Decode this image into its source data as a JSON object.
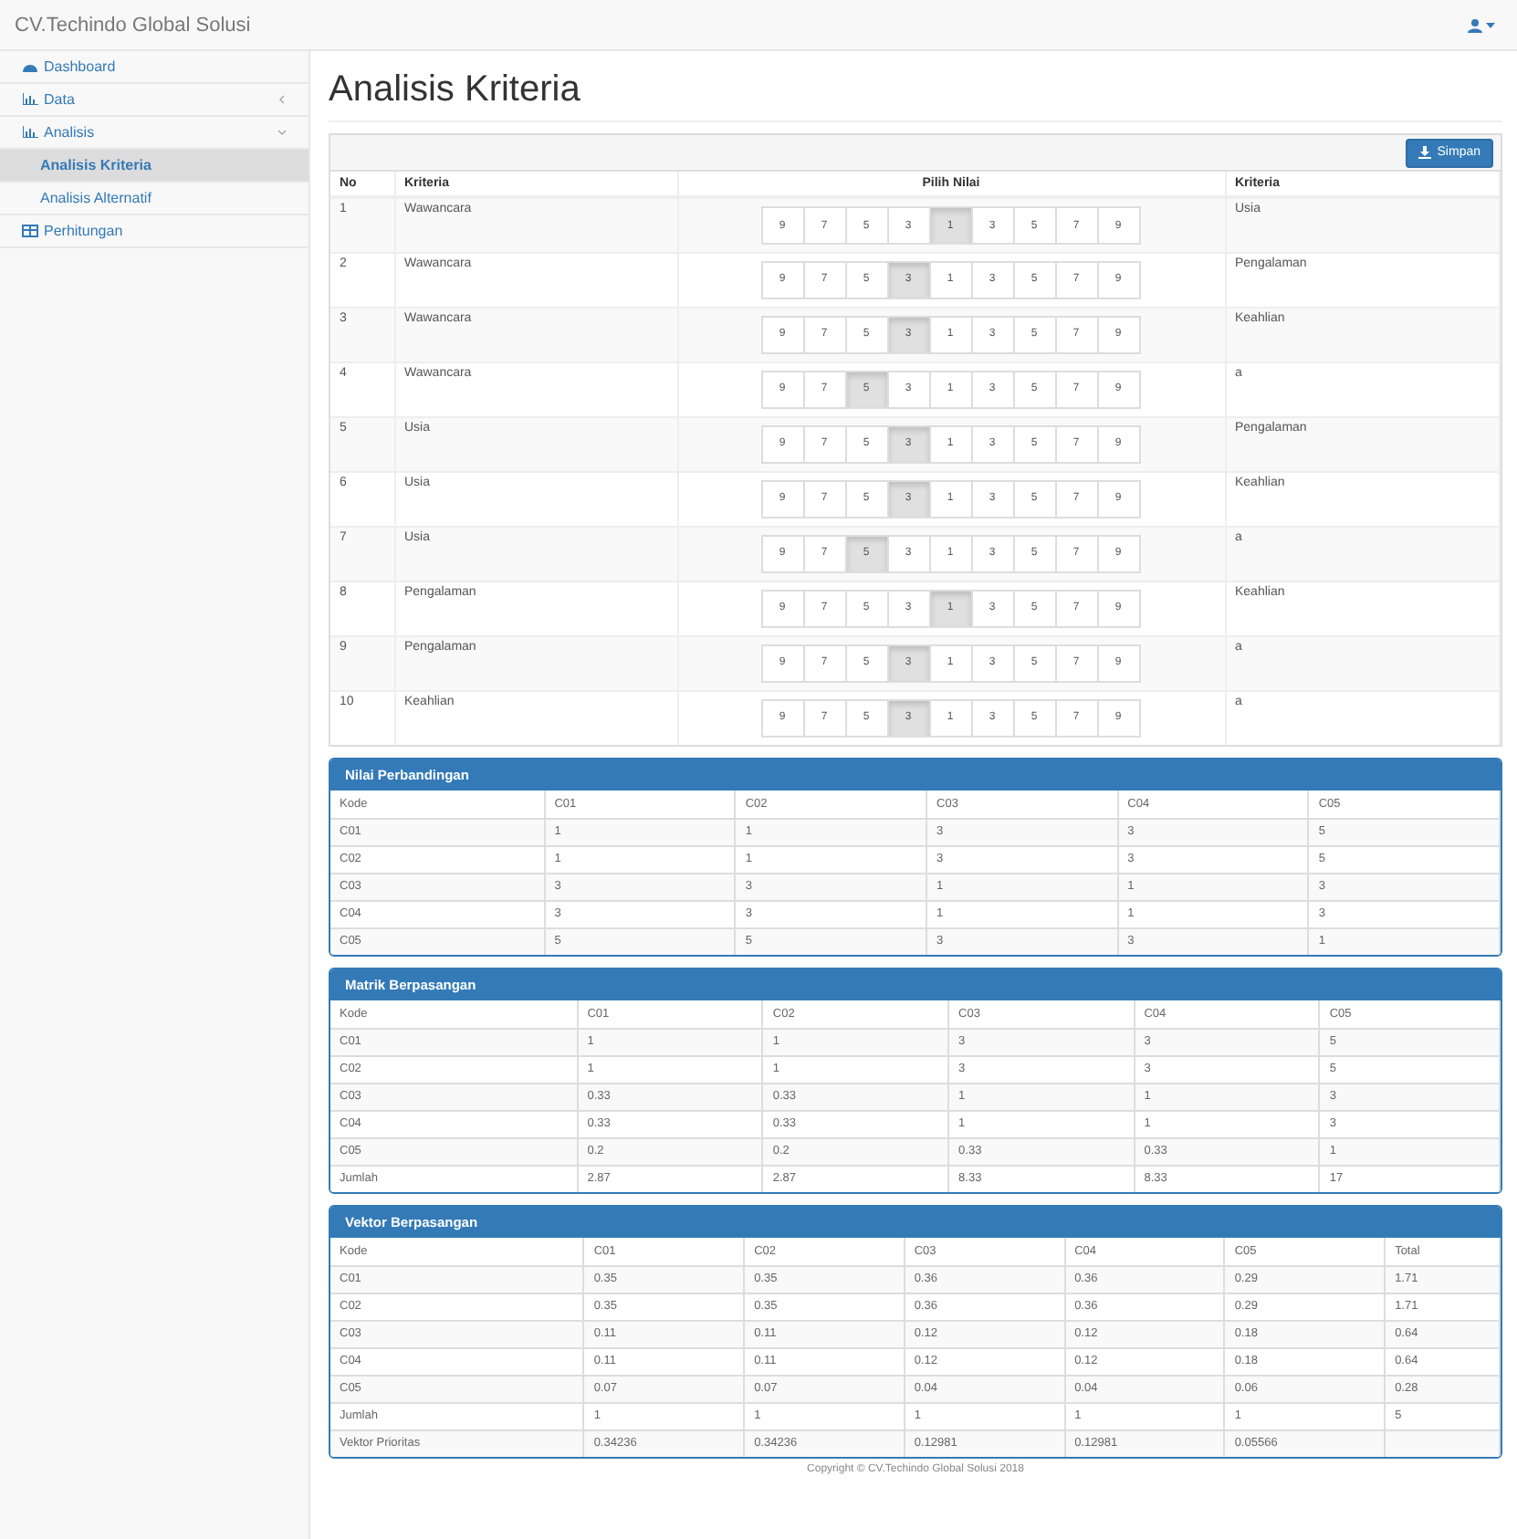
{
  "brand": "CV.Techindo Global Solusi",
  "sidebar": {
    "items": [
      {
        "label": "Dashboard",
        "selected": false
      },
      {
        "label": "Data",
        "selected": false,
        "expanded": false
      },
      {
        "label": "Analisis",
        "selected": false,
        "expanded": true,
        "children": [
          {
            "label": "Analisis Kriteria",
            "selected": true
          },
          {
            "label": "Analisis Alternatif",
            "selected": false
          }
        ]
      },
      {
        "label": "Perhitungan",
        "selected": false
      }
    ]
  },
  "page_title": "Analisis Kriteria",
  "save_button": "Simpan",
  "criteria_table": {
    "columns": [
      "No",
      "Kriteria",
      "Pilih Nilai",
      "Kriteria"
    ],
    "rows": [
      {
        "no": "1",
        "left": "Wawancara",
        "options": [
          {
            "label": "9",
            "selected": false
          },
          {
            "label": "7",
            "selected": false
          },
          {
            "label": "5",
            "selected": false
          },
          {
            "label": "3",
            "selected": false
          },
          {
            "label": "1",
            "selected": true
          },
          {
            "label": "3",
            "selected": false
          },
          {
            "label": "5",
            "selected": false
          },
          {
            "label": "7",
            "selected": false
          },
          {
            "label": "9",
            "selected": false
          }
        ],
        "right": "Usia"
      },
      {
        "no": "2",
        "left": "Wawancara",
        "options": [
          {
            "label": "9",
            "selected": false
          },
          {
            "label": "7",
            "selected": false
          },
          {
            "label": "5",
            "selected": false
          },
          {
            "label": "3",
            "selected": true
          },
          {
            "label": "1",
            "selected": false
          },
          {
            "label": "3",
            "selected": false
          },
          {
            "label": "5",
            "selected": false
          },
          {
            "label": "7",
            "selected": false
          },
          {
            "label": "9",
            "selected": false
          }
        ],
        "right": "Pengalaman"
      },
      {
        "no": "3",
        "left": "Wawancara",
        "options": [
          {
            "label": "9",
            "selected": false
          },
          {
            "label": "7",
            "selected": false
          },
          {
            "label": "5",
            "selected": false
          },
          {
            "label": "3",
            "selected": true
          },
          {
            "label": "1",
            "selected": false
          },
          {
            "label": "3",
            "selected": false
          },
          {
            "label": "5",
            "selected": false
          },
          {
            "label": "7",
            "selected": false
          },
          {
            "label": "9",
            "selected": false
          }
        ],
        "right": "Keahlian"
      },
      {
        "no": "4",
        "left": "Wawancara",
        "options": [
          {
            "label": "9",
            "selected": false
          },
          {
            "label": "7",
            "selected": false
          },
          {
            "label": "5",
            "selected": true
          },
          {
            "label": "3",
            "selected": false
          },
          {
            "label": "1",
            "selected": false
          },
          {
            "label": "3",
            "selected": false
          },
          {
            "label": "5",
            "selected": false
          },
          {
            "label": "7",
            "selected": false
          },
          {
            "label": "9",
            "selected": false
          }
        ],
        "right": "a"
      },
      {
        "no": "5",
        "left": "Usia",
        "options": [
          {
            "label": "9",
            "selected": false
          },
          {
            "label": "7",
            "selected": false
          },
          {
            "label": "5",
            "selected": false
          },
          {
            "label": "3",
            "selected": true
          },
          {
            "label": "1",
            "selected": false
          },
          {
            "label": "3",
            "selected": false
          },
          {
            "label": "5",
            "selected": false
          },
          {
            "label": "7",
            "selected": false
          },
          {
            "label": "9",
            "selected": false
          }
        ],
        "right": "Pengalaman"
      },
      {
        "no": "6",
        "left": "Usia",
        "options": [
          {
            "label": "9",
            "selected": false
          },
          {
            "label": "7",
            "selected": false
          },
          {
            "label": "5",
            "selected": false
          },
          {
            "label": "3",
            "selected": true
          },
          {
            "label": "1",
            "selected": false
          },
          {
            "label": "3",
            "selected": false
          },
          {
            "label": "5",
            "selected": false
          },
          {
            "label": "7",
            "selected": false
          },
          {
            "label": "9",
            "selected": false
          }
        ],
        "right": "Keahlian"
      },
      {
        "no": "7",
        "left": "Usia",
        "options": [
          {
            "label": "9",
            "selected": false
          },
          {
            "label": "7",
            "selected": false
          },
          {
            "label": "5",
            "selected": true
          },
          {
            "label": "3",
            "selected": false
          },
          {
            "label": "1",
            "selected": false
          },
          {
            "label": "3",
            "selected": false
          },
          {
            "label": "5",
            "selected": false
          },
          {
            "label": "7",
            "selected": false
          },
          {
            "label": "9",
            "selected": false
          }
        ],
        "right": "a"
      },
      {
        "no": "8",
        "left": "Pengalaman",
        "options": [
          {
            "label": "9",
            "selected": false
          },
          {
            "label": "7",
            "selected": false
          },
          {
            "label": "5",
            "selected": false
          },
          {
            "label": "3",
            "selected": false
          },
          {
            "label": "1",
            "selected": true
          },
          {
            "label": "3",
            "selected": false
          },
          {
            "label": "5",
            "selected": false
          },
          {
            "label": "7",
            "selected": false
          },
          {
            "label": "9",
            "selected": false
          }
        ],
        "right": "Keahlian"
      },
      {
        "no": "9",
        "left": "Pengalaman",
        "options": [
          {
            "label": "9",
            "selected": false
          },
          {
            "label": "7",
            "selected": false
          },
          {
            "label": "5",
            "selected": false
          },
          {
            "label": "3",
            "selected": true
          },
          {
            "label": "1",
            "selected": false
          },
          {
            "label": "3",
            "selected": false
          },
          {
            "label": "5",
            "selected": false
          },
          {
            "label": "7",
            "selected": false
          },
          {
            "label": "9",
            "selected": false
          }
        ],
        "right": "a"
      },
      {
        "no": "10",
        "left": "Keahlian",
        "options": [
          {
            "label": "9",
            "selected": false
          },
          {
            "label": "7",
            "selected": false
          },
          {
            "label": "5",
            "selected": false
          },
          {
            "label": "3",
            "selected": true
          },
          {
            "label": "1",
            "selected": false
          },
          {
            "label": "3",
            "selected": false
          },
          {
            "label": "5",
            "selected": false
          },
          {
            "label": "7",
            "selected": false
          },
          {
            "label": "9",
            "selected": false
          }
        ],
        "right": "a"
      }
    ]
  },
  "panels": [
    {
      "title": "Nilai Perbandingan",
      "columns": [
        "Kode",
        "C01",
        "C02",
        "C03",
        "C04",
        "C05"
      ],
      "rows": [
        [
          "C01",
          "1",
          "1",
          "3",
          "3",
          "5"
        ],
        [
          "C02",
          "1",
          "1",
          "3",
          "3",
          "5"
        ],
        [
          "C03",
          "3",
          "3",
          "1",
          "1",
          "3"
        ],
        [
          "C04",
          "3",
          "3",
          "1",
          "1",
          "3"
        ],
        [
          "C05",
          "5",
          "5",
          "3",
          "3",
          "1"
        ]
      ]
    },
    {
      "title": "Matrik Berpasangan",
      "columns": [
        "Kode",
        "C01",
        "C02",
        "C03",
        "C04",
        "C05"
      ],
      "rows": [
        [
          "C01",
          "1",
          "1",
          "3",
          "3",
          "5"
        ],
        [
          "C02",
          "1",
          "1",
          "3",
          "3",
          "5"
        ],
        [
          "C03",
          "0.33",
          "0.33",
          "1",
          "1",
          "3"
        ],
        [
          "C04",
          "0.33",
          "0.33",
          "1",
          "1",
          "3"
        ],
        [
          "C05",
          "0.2",
          "0.2",
          "0.33",
          "0.33",
          "1"
        ],
        [
          "Jumlah",
          "2.87",
          "2.87",
          "8.33",
          "8.33",
          "17"
        ]
      ]
    },
    {
      "title": "Vektor Berpasangan",
      "columns": [
        "Kode",
        "C01",
        "C02",
        "C03",
        "C04",
        "C05",
        "Total"
      ],
      "rows": [
        [
          "C01",
          "0.35",
          "0.35",
          "0.36",
          "0.36",
          "0.29",
          "1.71"
        ],
        [
          "C02",
          "0.35",
          "0.35",
          "0.36",
          "0.36",
          "0.29",
          "1.71"
        ],
        [
          "C03",
          "0.11",
          "0.11",
          "0.12",
          "0.12",
          "0.18",
          "0.64"
        ],
        [
          "C04",
          "0.11",
          "0.11",
          "0.12",
          "0.12",
          "0.18",
          "0.64"
        ],
        [
          "C05",
          "0.07",
          "0.07",
          "0.04",
          "0.04",
          "0.06",
          "0.28"
        ],
        [
          "Jumlah",
          "1",
          "1",
          "1",
          "1",
          "1",
          "5"
        ],
        [
          "Vektor Prioritas",
          "0.34236",
          "0.34236",
          "0.12981",
          "0.12981",
          "0.05566"
        ]
      ]
    }
  ],
  "footer": "Copyright © CV.Techindo Global Solusi 2018"
}
